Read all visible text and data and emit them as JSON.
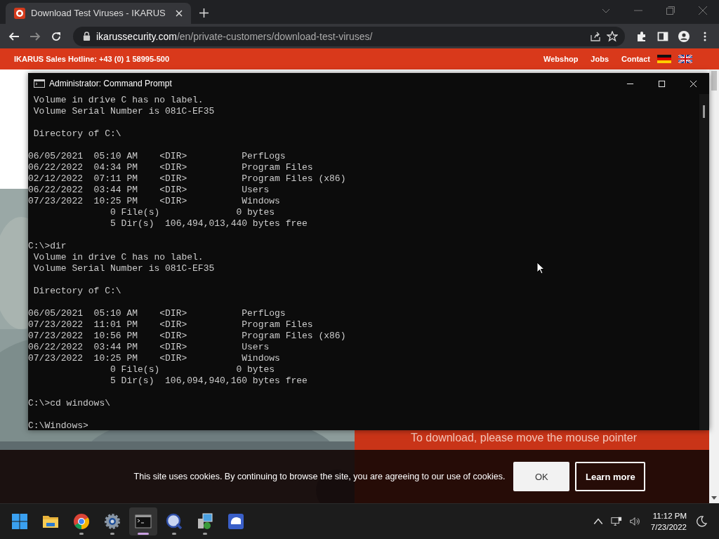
{
  "browser": {
    "tab": {
      "title": "Download Test Viruses - IKARUS",
      "selected": true
    },
    "url_host": "ikarussecurity.com",
    "url_path": "/en/private-customers/download-test-viruses/"
  },
  "site": {
    "hotline": "IKARUS Sales Hotline: +43 (0) 1 58995-500",
    "links": [
      "Webshop",
      "Jobs",
      "Contact"
    ],
    "panel_text": "To download, please move the mouse pointer"
  },
  "console": {
    "title": "Administrator: Command Prompt",
    "blocks": [
      [
        " Volume in drive C has no label.",
        " Volume Serial Number is 081C-EF35"
      ],
      [
        " Directory of C:\\"
      ],
      [
        "06/05/2021  05:10 AM    <DIR>          PerfLogs",
        "06/22/2022  04:34 PM    <DIR>          Program Files",
        "02/12/2022  07:11 PM    <DIR>          Program Files (x86)",
        "06/22/2022  03:44 PM    <DIR>          Users",
        "07/23/2022  10:25 PM    <DIR>          Windows",
        "               0 File(s)              0 bytes",
        "               5 Dir(s)  106,494,013,440 bytes free"
      ],
      [
        "C:\\>dir",
        " Volume in drive C has no label.",
        " Volume Serial Number is 081C-EF35"
      ],
      [
        " Directory of C:\\"
      ],
      [
        "06/05/2021  05:10 AM    <DIR>          PerfLogs",
        "07/23/2022  11:01 PM    <DIR>          Program Files",
        "07/23/2022  10:56 PM    <DIR>          Program Files (x86)",
        "06/22/2022  03:44 PM    <DIR>          Users",
        "07/23/2022  10:25 PM    <DIR>          Windows",
        "               0 File(s)              0 bytes",
        "               5 Dir(s)  106,094,940,160 bytes free"
      ],
      [
        "C:\\>cd windows\\"
      ],
      [
        "C:\\Windows>"
      ]
    ]
  },
  "cookie_banner": {
    "text": "This site uses cookies. By continuing to browse the site, you are agreeing to our use of cookies.",
    "buttons": [
      {
        "label": "OK",
        "kind": "primary"
      },
      {
        "label": "Learn more",
        "kind": "outline"
      }
    ]
  },
  "taskbar": {
    "apps": [
      {
        "kind": "start",
        "running": false,
        "selected": false
      },
      {
        "kind": "folder",
        "running": false,
        "selected": false
      },
      {
        "kind": "browser",
        "running": true,
        "selected": false
      },
      {
        "kind": "settings",
        "running": true,
        "selected": false
      },
      {
        "kind": "terminal",
        "running": true,
        "selected": true
      },
      {
        "kind": "magnifier",
        "running": true,
        "selected": false
      },
      {
        "kind": "installer",
        "running": true,
        "selected": false
      },
      {
        "kind": "remote",
        "running": false,
        "selected": false
      }
    ],
    "time": "11:12 PM",
    "date": "7/23/2022"
  }
}
